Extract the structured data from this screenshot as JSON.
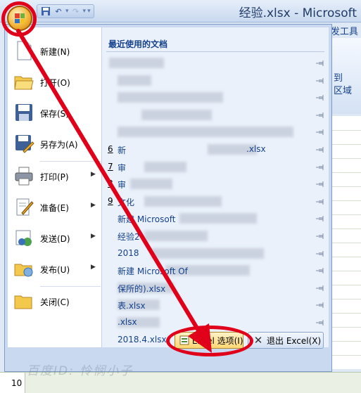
{
  "window": {
    "title": "经验.xlsx - Microsoft"
  },
  "qat": {
    "save_icon": "save-icon",
    "undo_icon": "undo-icon",
    "redo_icon": "redo-icon"
  },
  "ribbon": {
    "tab_label": "发工具",
    "group_label_1": "到",
    "group_label_2": "区域"
  },
  "menu": {
    "items": [
      {
        "label": "新建(N)",
        "icon": "new-document-icon"
      },
      {
        "label": "打开(O)",
        "icon": "open-folder-icon"
      },
      {
        "label": "保存(S)",
        "icon": "save-icon"
      },
      {
        "label": "另存为(A)",
        "icon": "save-as-icon"
      },
      {
        "label": "打印(P)",
        "icon": "print-icon"
      },
      {
        "label": "准备(E)",
        "icon": "prepare-icon"
      },
      {
        "label": "发送(D)",
        "icon": "send-icon"
      },
      {
        "label": "发布(U)",
        "icon": "publish-icon"
      },
      {
        "label": "关闭(C)",
        "icon": "close-folder-icon"
      }
    ],
    "recent_title": "最近使用的文档",
    "recent": [
      {
        "num": "",
        "name": ""
      },
      {
        "num": "",
        "name": ""
      },
      {
        "num": "",
        "name": ""
      },
      {
        "num": "",
        "name": ""
      },
      {
        "num": "",
        "name": ""
      },
      {
        "num": "6",
        "name": "新",
        "suffix": ".xlsx"
      },
      {
        "num": "7",
        "name": "审"
      },
      {
        "num": "8",
        "name": "审"
      },
      {
        "num": "9",
        "name": "文化"
      },
      {
        "num": "",
        "name": "新建 Microsoft"
      },
      {
        "num": "",
        "name": "经验2"
      },
      {
        "num": "",
        "name": "2018"
      },
      {
        "num": "",
        "name": "新建 Microsoft Of"
      },
      {
        "num": "",
        "name": "保所的).xlsx"
      },
      {
        "num": "",
        "name": "表.xlsx"
      },
      {
        "num": "",
        "name": ".xlsx"
      },
      {
        "num": "",
        "name": "2018.4.xlsx"
      }
    ],
    "excel_options": "Excel 选项(I)",
    "exit_excel": "退出 Excel(X)"
  },
  "status": {
    "row_number": "10"
  },
  "watermark": "百度ID: 怜悯小子"
}
